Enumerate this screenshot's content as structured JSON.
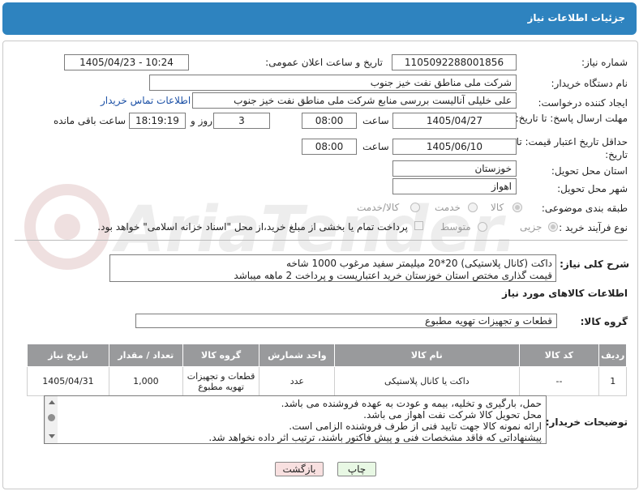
{
  "header": {
    "title": "جزئیات اطلاعات نیاز"
  },
  "watermark": {
    "text": "AriaTender.neT"
  },
  "form": {
    "need_number": {
      "label": "شماره نیاز:",
      "value": "1105092288001856"
    },
    "announce_datetime": {
      "label": "تاریخ و ساعت اعلان عمومی:",
      "value": "1405/04/23 - 10:24"
    },
    "buyer_org": {
      "label": "نام دستگاه خریدار:",
      "value": "شرکت ملی مناطق نفت خیز جنوب"
    },
    "requester": {
      "label": "ایجاد کننده درخواست:",
      "value": "علی  خلیلی  آنالیست بررسی منابع شرکت ملی مناطق نفت خیز جنوب",
      "contact_link": "اطلاعات تماس خریدار"
    },
    "response_deadline": {
      "label": "مهلت ارسال پاسخ: تا تاریخ:",
      "date": "1405/04/27",
      "time_label": "ساعت",
      "time": "08:00",
      "days": "3",
      "days_label": "روز و",
      "remaining": "18:19:19",
      "remaining_label": "ساعت باقی مانده"
    },
    "price_validity": {
      "label": "حداقل تاریخ اعتبار قیمت: تا تاریخ:",
      "date": "1405/06/10",
      "time_label": "ساعت",
      "time": "08:00"
    },
    "delivery_province": {
      "label": "استان محل تحویل:",
      "value": "خوزستان"
    },
    "delivery_city": {
      "label": "شهر محل تحویل:",
      "value": "اهواز"
    },
    "category": {
      "label": "طبقه بندی موضوعی:",
      "options": [
        "کالا",
        "خدمت",
        "کالا/خدمت"
      ],
      "selected": "کالا"
    },
    "process_type": {
      "label": "نوع فرآیند خرید :",
      "options": [
        "جزیی",
        "متوسط"
      ],
      "selected": "جزیی",
      "payment_note": "پرداخت تمام یا بخشی از مبلغ خرید،از محل \"اسناد خزانه اسلامی\" خواهد بود."
    }
  },
  "description": {
    "label": "شرح کلی نیاز:",
    "line1": "داکت (کانال پلاستیکی) 20*20  میلیمتر سفید مرغوب    1000 شاخه",
    "line2": "قیمت گذاری مختص استان خوزستان     خرید اعتباریست و پرداخت 2 ماهه میباشد"
  },
  "goods_info": {
    "section_title": "اطلاعات کالاهای مورد نیاز",
    "group_label": "گروه کالا:",
    "group_value": "قطعات و تجهیزات تهویه مطبوع"
  },
  "table": {
    "headers": [
      "ردیف",
      "کد کالا",
      "نام کالا",
      "واحد شمارش",
      "گروه کالا",
      "تعداد / مقدار",
      "تاریخ نیاز"
    ],
    "rows": [
      {
        "row": "1",
        "code": "--",
        "name": "داکت یا کانال پلاستیکی",
        "unit": "عدد",
        "group": "قطعات و تجهیزات تهویه مطبوع",
        "qty": "1,000",
        "date": "1405/04/31"
      }
    ]
  },
  "buyer_notes": {
    "label": "توضیحات خریدار:",
    "lines": [
      "حمل، بارگیری و تخلیه، بیمه و عودت به عهده فروشنده می باشد.",
      "محل تحویل کالا شرکت نفت اهواز می باشد.",
      "ارائه نمونه کالا جهت تایید فنی از طرف فروشنده الزامی است.",
      "پیشنهاداتی که فاقد مشخصات فنی و پیش فاکتور باشند، ترتیب اثر داده نخواهد شد."
    ]
  },
  "buttons": {
    "print": "چاپ",
    "back": "بازگشت"
  },
  "colors": {
    "header_bg": "#2e83bf",
    "table_header_bg": "#999a9c",
    "print_btn": "#e8f8e4",
    "back_btn": "#f8e0e0"
  }
}
